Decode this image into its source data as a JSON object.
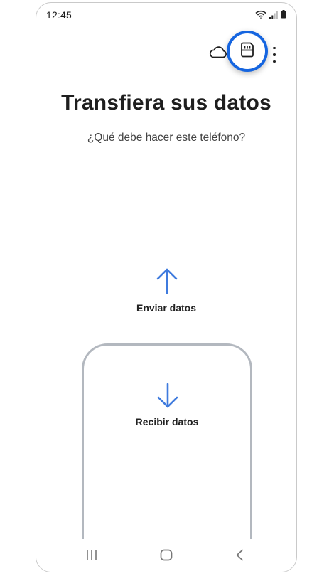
{
  "status_bar": {
    "time": "12:45",
    "icons": [
      "wifi-icon",
      "signal-icon",
      "battery-icon"
    ]
  },
  "toolbar": {
    "icons": [
      "cloud-icon",
      "sd-card-icon",
      "more-options-icon"
    ],
    "highlight_color": "#1565e0"
  },
  "main": {
    "title": "Transfiera sus datos",
    "subtitle": "¿Qué debe hacer este teléfono?",
    "send": {
      "label": "Enviar datos",
      "icon": "arrow-up-icon"
    },
    "receive": {
      "label": "Recibir datos",
      "icon": "arrow-down-icon"
    },
    "accent_color": "#3f7bde"
  },
  "nav_bar": {
    "buttons": [
      "recents-icon",
      "home-icon",
      "back-icon"
    ]
  }
}
